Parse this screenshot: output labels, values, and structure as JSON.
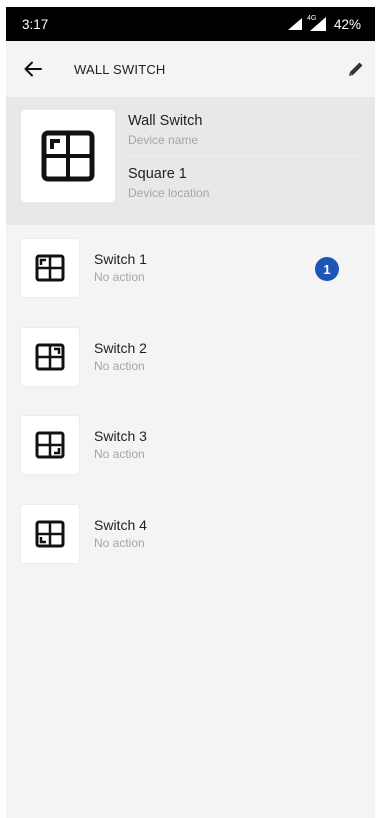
{
  "status_bar": {
    "time": "3:17",
    "network_label": "4G",
    "battery": "42%",
    "icons": [
      "signal-icon",
      "signal-4g-icon"
    ]
  },
  "app_bar": {
    "title": "WALL SWITCH",
    "back_icon": "back-arrow-icon",
    "edit_icon": "pencil-icon"
  },
  "device": {
    "icon": "wall-switch-4-gang-icon",
    "name": "Wall Switch",
    "name_caption": "Device name",
    "location": "Square 1",
    "location_caption": "Device location"
  },
  "switches": [
    {
      "name": "Switch 1",
      "status": "No action",
      "icon": "switch-1-icon",
      "badge": "1"
    },
    {
      "name": "Switch 2",
      "status": "No action",
      "icon": "switch-2-icon"
    },
    {
      "name": "Switch 3",
      "status": "No action",
      "icon": "switch-3-icon"
    },
    {
      "name": "Switch 4",
      "status": "No action",
      "icon": "switch-4-icon"
    }
  ],
  "colors": {
    "badge": "#1e56b7",
    "status_bar_bg": "#000000",
    "card_bg": "#e8e8e8",
    "page_bg": "#f4f4f4"
  }
}
